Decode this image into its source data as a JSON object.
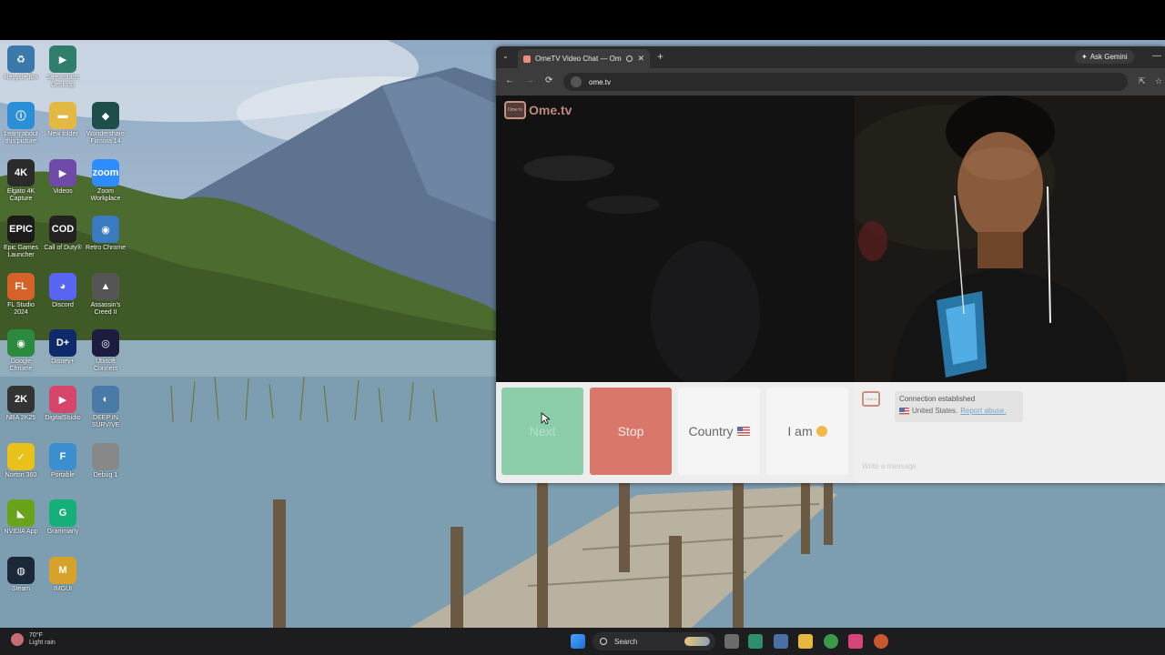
{
  "desktop": {
    "icons": [
      {
        "label": "Recycle Bin",
        "glyph": "♻",
        "color": "#3a79a9"
      },
      {
        "label": "Streamlabs Desktop",
        "glyph": "▶",
        "color": "#2f7d6a"
      },
      {
        "label": "Learn about this picture",
        "glyph": "ⓘ",
        "color": "#2a8fd6"
      },
      {
        "label": "New folder",
        "glyph": "▬",
        "color": "#e3b943"
      },
      {
        "label": "Wondershare Filmora 14",
        "glyph": "◆",
        "color": "#1f4e4a"
      },
      {
        "label": "Elgato 4K Capture",
        "glyph": "4K",
        "color": "#2b2b2b"
      },
      {
        "label": "Videos",
        "glyph": "▶",
        "color": "#6f4aa8"
      },
      {
        "label": "Zoom Workplace",
        "glyph": "zoom",
        "color": "#2d8cff"
      },
      {
        "label": "Epic Games Launcher",
        "glyph": "EPIC",
        "color": "#1b1b1b"
      },
      {
        "label": "Call of Duty®",
        "glyph": "COD",
        "color": "#222"
      },
      {
        "label": "Retro Chrome",
        "glyph": "◉",
        "color": "#3a7ac0"
      },
      {
        "label": "FL Studio 2024",
        "glyph": "FL",
        "color": "#d6622a"
      },
      {
        "label": "Discord",
        "glyph": "◕",
        "color": "#5865f2"
      },
      {
        "label": "Assassin's Creed II",
        "glyph": "▲",
        "color": "#555"
      },
      {
        "label": "Google Chrome",
        "glyph": "◉",
        "color": "#2b8a3e"
      },
      {
        "label": "Disney+",
        "glyph": "D+",
        "color": "#0e2a6a"
      },
      {
        "label": "Ubisoft Connect",
        "glyph": "◎",
        "color": "#1c1c40"
      },
      {
        "label": "NBA 2K25",
        "glyph": "2K",
        "color": "#333"
      },
      {
        "label": "DigitalStudio",
        "glyph": "▶",
        "color": "#d6456a"
      },
      {
        "label": "DEEP IN SURVIVE",
        "glyph": "◐",
        "color": "#4a7aa8"
      },
      {
        "label": "Norton 360",
        "glyph": "✓",
        "color": "#e8c21a"
      },
      {
        "label": "Portable",
        "glyph": "F",
        "color": "#3b8fcf"
      },
      {
        "label": "Debug 1",
        "glyph": "",
        "color": "#888"
      },
      {
        "label": "NVIDIA App",
        "glyph": "◣",
        "color": "#6aa21a"
      },
      {
        "label": "Grammarly",
        "glyph": "G",
        "color": "#15b07a"
      },
      {
        "label": "Steam",
        "glyph": "◍",
        "color": "#1b2838"
      },
      {
        "label": "IMGUI",
        "glyph": "M",
        "color": "#d6a22a"
      }
    ]
  },
  "browser": {
    "tab_title": "OmeTV Video Chat — Ome",
    "new_tab": "+",
    "tab_close": "✕",
    "tab_search": "⌄",
    "gemini_label": "Ask Gemini",
    "minimize": "—",
    "back": "←",
    "forward": "→",
    "reload": "⟳",
    "url": "ome.tv",
    "install_icon": "⇱",
    "bookmark_icon": "☆"
  },
  "page": {
    "logo_text": "Ome.tv",
    "logo_box": "Ome tv",
    "buttons": {
      "next": "Next",
      "stop": "Stop",
      "country": "Country",
      "iam": "I am"
    },
    "chat": {
      "message_title": "Connection established",
      "country": "United States.",
      "report_link": "Report abuse.",
      "input_placeholder": "Write a message"
    }
  },
  "taskbar": {
    "temperature": "70°F",
    "condition": "Light rain",
    "search_placeholder": "Search"
  },
  "colors": {
    "next": "#8ccdaa",
    "stop": "#d9776a",
    "brand": "#c0887a"
  }
}
